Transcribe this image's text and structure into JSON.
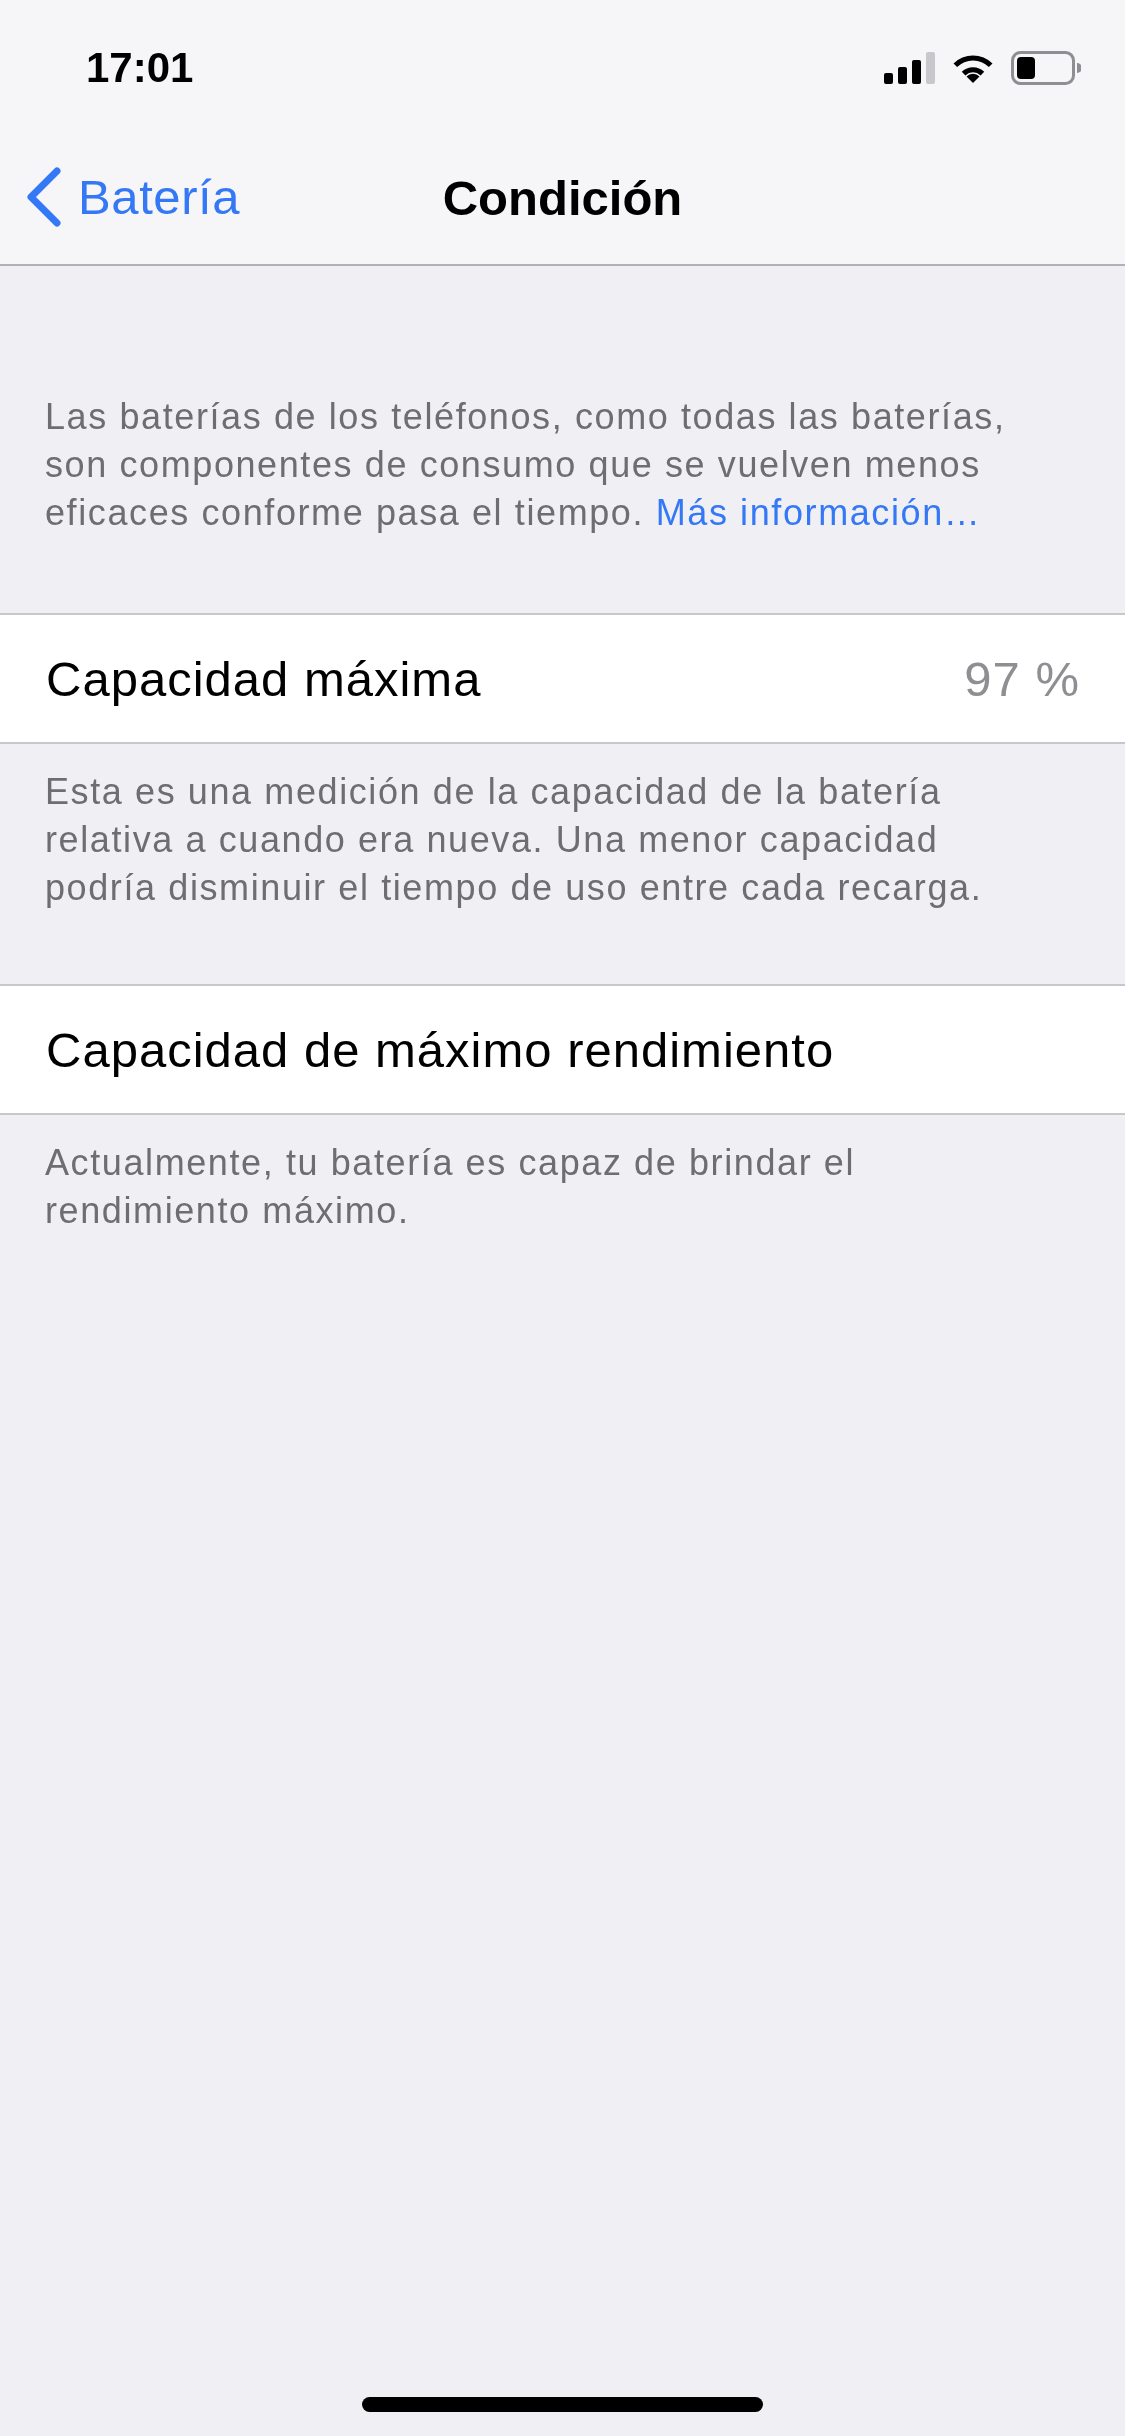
{
  "status_bar": {
    "time": "17:01"
  },
  "nav_bar": {
    "back_label": "Batería",
    "title": "Condición"
  },
  "intro": {
    "text": "Las baterías de los teléfonos, como todas las baterías, son componentes de consumo que se vuelven menos eficaces conforme pasa el tiempo.",
    "link": "Más información…"
  },
  "sections": [
    {
      "label": "Capacidad máxima",
      "value": "97 %",
      "footer": "Esta es una medición de la capacidad de la batería relativa a cuando era nueva. Una menor capacidad podría disminuir el tiempo de uso entre cada recarga."
    },
    {
      "label": "Capacidad de máximo rendimiento",
      "footer": "Actualmente, tu batería es capaz de brindar el rendimiento máximo."
    }
  ]
}
